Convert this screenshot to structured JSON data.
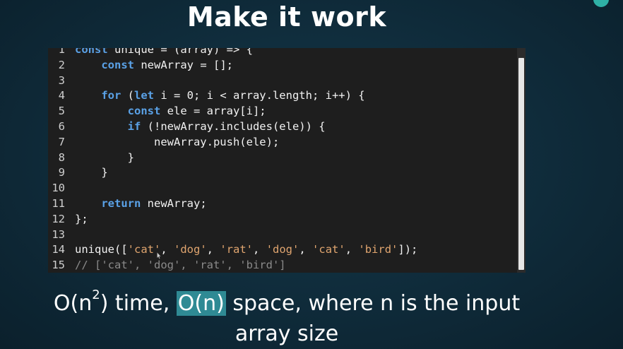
{
  "slide": {
    "title": "Make it work"
  },
  "code_editor": {
    "lines": [
      {
        "number": "1",
        "tokens": [
          {
            "t": "kw",
            "v": "const"
          },
          {
            "t": "plain",
            "v": " unique = (array) => {"
          }
        ]
      },
      {
        "number": "2",
        "tokens": [
          {
            "t": "plain",
            "v": "    "
          },
          {
            "t": "kw",
            "v": "const"
          },
          {
            "t": "plain",
            "v": " newArray = [];"
          }
        ]
      },
      {
        "number": "3",
        "tokens": []
      },
      {
        "number": "4",
        "tokens": [
          {
            "t": "plain",
            "v": "    "
          },
          {
            "t": "kw",
            "v": "for"
          },
          {
            "t": "plain",
            "v": " ("
          },
          {
            "t": "kw",
            "v": "let"
          },
          {
            "t": "plain",
            "v": " i = 0; i < array.length; i++) {"
          }
        ]
      },
      {
        "number": "5",
        "tokens": [
          {
            "t": "plain",
            "v": "        "
          },
          {
            "t": "kw",
            "v": "const"
          },
          {
            "t": "plain",
            "v": " ele = array[i];"
          }
        ]
      },
      {
        "number": "6",
        "tokens": [
          {
            "t": "plain",
            "v": "        "
          },
          {
            "t": "kw",
            "v": "if"
          },
          {
            "t": "plain",
            "v": " (!newArray.includes(ele)) {"
          }
        ]
      },
      {
        "number": "7",
        "tokens": [
          {
            "t": "plain",
            "v": "            newArray.push(ele);"
          }
        ]
      },
      {
        "number": "8",
        "tokens": [
          {
            "t": "plain",
            "v": "        }"
          }
        ]
      },
      {
        "number": "9",
        "tokens": [
          {
            "t": "plain",
            "v": "    }"
          }
        ]
      },
      {
        "number": "10",
        "tokens": []
      },
      {
        "number": "11",
        "tokens": [
          {
            "t": "plain",
            "v": "    "
          },
          {
            "t": "kw",
            "v": "return"
          },
          {
            "t": "plain",
            "v": " newArray;"
          }
        ]
      },
      {
        "number": "12",
        "tokens": [
          {
            "t": "plain",
            "v": "};"
          }
        ]
      },
      {
        "number": "13",
        "tokens": []
      },
      {
        "number": "14",
        "tokens": [
          {
            "t": "plain",
            "v": "unique(["
          },
          {
            "t": "str",
            "v": "'cat'"
          },
          {
            "t": "plain",
            "v": ", "
          },
          {
            "t": "str",
            "v": "'dog'"
          },
          {
            "t": "plain",
            "v": ", "
          },
          {
            "t": "str",
            "v": "'rat'"
          },
          {
            "t": "plain",
            "v": ", "
          },
          {
            "t": "str",
            "v": "'dog'"
          },
          {
            "t": "plain",
            "v": ", "
          },
          {
            "t": "str",
            "v": "'cat'"
          },
          {
            "t": "plain",
            "v": ", "
          },
          {
            "t": "str",
            "v": "'bird'"
          },
          {
            "t": "plain",
            "v": "]);"
          }
        ]
      },
      {
        "number": "15",
        "tokens": [
          {
            "t": "cmt",
            "v": "// ['cat', 'dog', 'rat', 'bird']"
          }
        ]
      }
    ]
  },
  "caption": {
    "part1": "O(n",
    "exponent": "2",
    "part2": ") time, ",
    "highlighted": "O(n)",
    "part3": " space, where n is the input",
    "line2": "array size"
  },
  "colors": {
    "keyword": "#5aa1e6",
    "string": "#e0a56f",
    "comment": "#8a8a8a",
    "highlight": "#2f8a94",
    "accent_badge": "#2fb1a6"
  }
}
